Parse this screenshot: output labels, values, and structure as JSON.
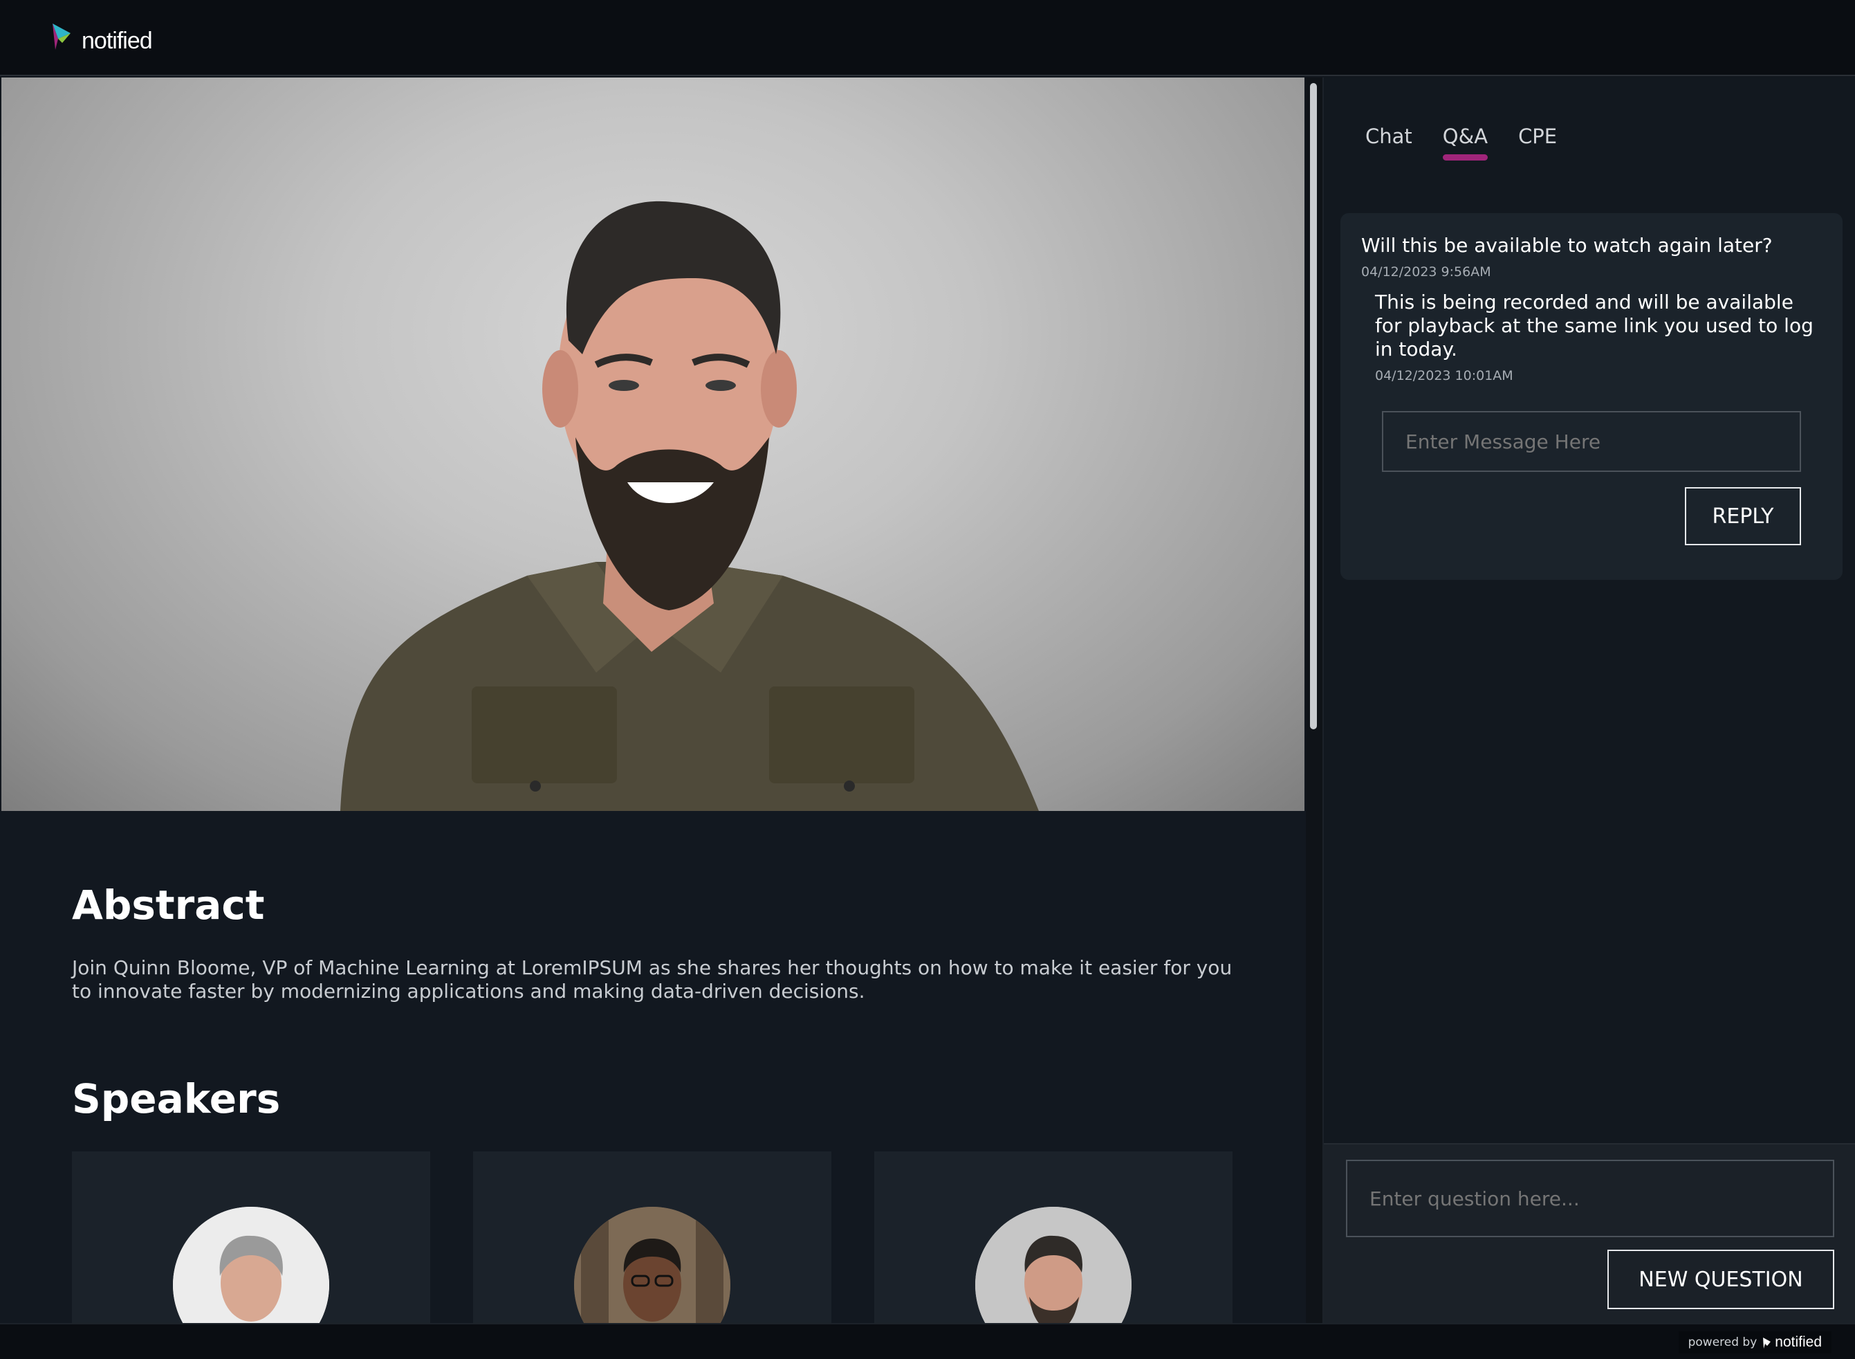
{
  "brand": {
    "name": "notified",
    "colors": {
      "accent": "#a0257a",
      "logo_teal": "#2fb4c8",
      "logo_green": "#8cc63f",
      "logo_purple": "#a0257a"
    }
  },
  "content": {
    "abstract_title": "Abstract",
    "abstract_text": "Join Quinn Bloome, VP of Machine Learning at LoremIPSUM as she shares her thoughts on how to make it easier for you to innovate faster by modernizing applications and making data-driven decisions.",
    "speakers_title": "Speakers"
  },
  "sidebar": {
    "tabs": [
      {
        "label": "Chat",
        "active": false
      },
      {
        "label": "Q&A",
        "active": true
      },
      {
        "label": "CPE",
        "active": false
      }
    ],
    "qa": {
      "question": "Will this be available to watch again later?",
      "question_time": "04/12/2023 9:56AM",
      "answer": "This is being recorded and will be available for playback at the same link you used to log in today.",
      "answer_time": "04/12/2023 10:01AM",
      "reply_placeholder": "Enter Message Here",
      "reply_button": "REPLY"
    },
    "question_placeholder": "Enter question here...",
    "new_question_button": "NEW QUESTION"
  },
  "footer": {
    "powered_by": "powered by",
    "logo_text": "notified"
  }
}
